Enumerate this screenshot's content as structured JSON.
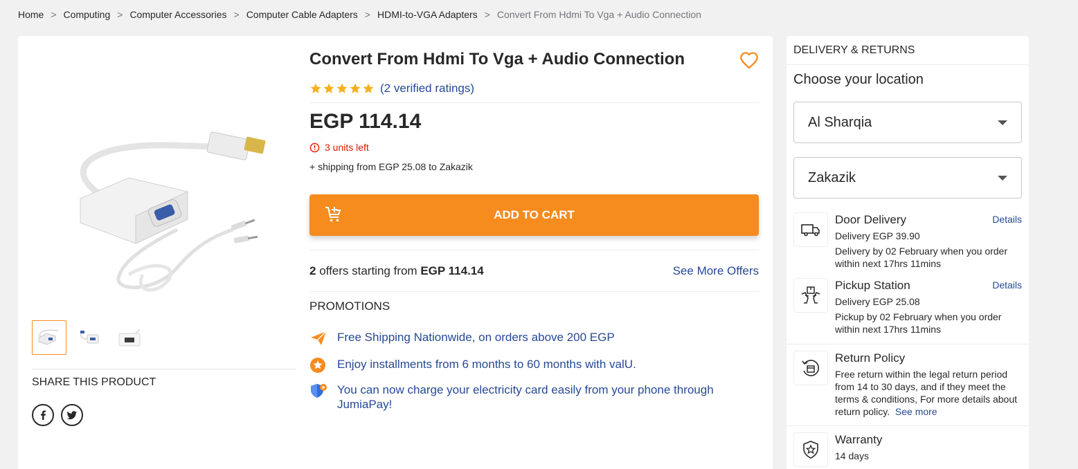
{
  "breadcrumb": [
    "Home",
    "Computing",
    "Computer Accessories",
    "Computer Cable Adapters",
    "HDMI-to-VGA Adapters",
    "Convert From Hdmi To Vga + Audio Connection"
  ],
  "breadcrumb_separator": ">",
  "product": {
    "title": "Convert From Hdmi To Vga + Audio Connection",
    "rating_stars": 5,
    "ratings_link": "(2 verified ratings)",
    "price": "EGP 114.14",
    "stock": "3 units left",
    "shipping": "+ shipping from EGP 25.08 to Zakazik",
    "add_to_cart": "ADD TO CART",
    "offers_count": "2",
    "offers_text": " offers starting from ",
    "offers_price": "EGP 114.14",
    "see_more_offers": "See More Offers"
  },
  "promotions": {
    "title": "PROMOTIONS",
    "items": [
      "Free Shipping Nationwide, on orders above 200 EGP",
      "Enjoy installments from 6 months to 60 months with valU.",
      "You can now charge your electricity card easily from your phone through JumiaPay!"
    ]
  },
  "share": {
    "title": "SHARE THIS PRODUCT",
    "icons": [
      "facebook-icon",
      "twitter-icon"
    ]
  },
  "delivery": {
    "header": "DELIVERY & RETURNS",
    "choose_location": "Choose your location",
    "region": "Al Sharqia",
    "city": "Zakazik",
    "door": {
      "title": "Door Delivery",
      "details": "Details",
      "fee": "Delivery EGP 39.90",
      "desc": "Delivery by 02 February when you order within next 17hrs 11mins"
    },
    "pickup": {
      "title": "Pickup Station",
      "details": "Details",
      "fee": "Delivery EGP 25.08",
      "desc": "Pickup by 02 February when you order within next 17hrs 11mins"
    },
    "returns": {
      "title": "Return Policy",
      "desc": "Free return within the legal return period from 14 to 30 days, and if they meet the terms & conditions, For more details about return policy.",
      "see_more": "See more"
    },
    "warranty": {
      "title": "Warranty",
      "desc": "14 days"
    }
  },
  "colors": {
    "accent": "#f68b1e",
    "link": "#264996",
    "star": "#f6b01e",
    "alert": "#e61601"
  }
}
